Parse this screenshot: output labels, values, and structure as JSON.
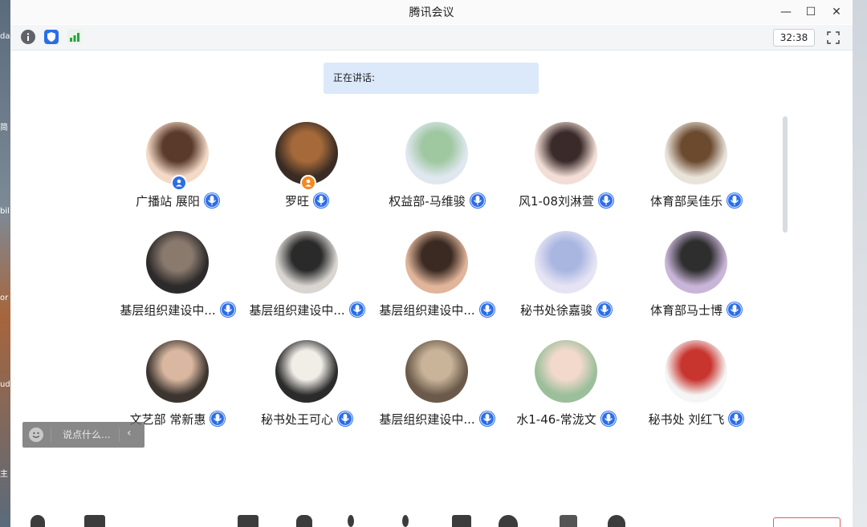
{
  "window": {
    "title": "腾讯会议",
    "controls": {
      "minimize": "—",
      "maximize": "☐",
      "close": "✕"
    }
  },
  "desktop": {
    "left_labels": [
      "da",
      "简",
      "bil",
      "or",
      "ud",
      "主"
    ]
  },
  "top_toolbar": {
    "timer": "32:38",
    "icons": [
      "info-icon",
      "shield-icon",
      "signal-icon",
      "fullscreen-icon"
    ]
  },
  "speaking_label": "正在讲话:",
  "participants": [
    {
      "name": "广播站 展阳",
      "badge": "host",
      "colors": [
        "#f4d9c6",
        "#5a3a2a"
      ]
    },
    {
      "name": "罗旺",
      "badge": "cohost",
      "colors": [
        "#3a2c24",
        "#a66a3a"
      ]
    },
    {
      "name": "权益部-马维骏",
      "colors": [
        "#dfe7ef",
        "#9fc7a0"
      ]
    },
    {
      "name": "风1-08刘淋萱",
      "colors": [
        "#f2ded6",
        "#3a2a2a"
      ]
    },
    {
      "name": "体育部吴佳乐",
      "colors": [
        "#e9e3da",
        "#6b4a2e"
      ]
    },
    {
      "name": "基层组织建设中...",
      "colors": [
        "#2c2a2a",
        "#8a7a6e"
      ]
    },
    {
      "name": "基层组织建设中...",
      "colors": [
        "#d9d6d2",
        "#2a2a2a"
      ]
    },
    {
      "name": "基层组织建设中...",
      "colors": [
        "#e0b59a",
        "#3a2a22"
      ]
    },
    {
      "name": "秘书处徐嘉骏",
      "colors": [
        "#e6e4f4",
        "#a9b6e0"
      ]
    },
    {
      "name": "体育部马士博",
      "colors": [
        "#c9b5d8",
        "#2e2e2e"
      ]
    },
    {
      "name": "文艺部 常新惠",
      "colors": [
        "#3b342f",
        "#d9b7a0"
      ]
    },
    {
      "name": "秘书处王可心",
      "colors": [
        "#2b2b2b",
        "#f1eee8"
      ]
    },
    {
      "name": "基层组织建设中...",
      "colors": [
        "#6b5a4a",
        "#c9b49a"
      ]
    },
    {
      "name": "水1-46-常泷文",
      "colors": [
        "#9bbf9a",
        "#f2d9cc"
      ]
    },
    {
      "name": "秘书处 刘红飞",
      "colors": [
        "#f5f5f5",
        "#c8342e"
      ]
    }
  ],
  "chat": {
    "placeholder": "说点什么...",
    "collapse": "‹"
  },
  "theme": {
    "accent": "#2b6de8",
    "speaking_bg": "#dbe9fb",
    "end_button": "#e25b5b"
  }
}
